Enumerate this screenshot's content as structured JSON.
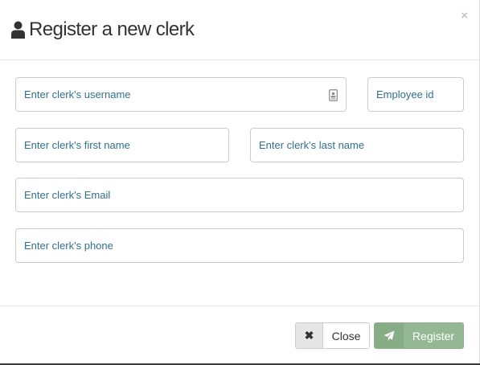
{
  "header": {
    "title": "Register a new clerk",
    "close_glyph": "×"
  },
  "form": {
    "username_placeholder": "Enter clerk's username",
    "employee_id_placeholder": "Employee id",
    "first_name_placeholder": "Enter clerk's first name",
    "last_name_placeholder": "Enter clerk's last name",
    "email_placeholder": "Enter clerk's Email",
    "phone_placeholder": "Enter clerk's phone"
  },
  "footer": {
    "close_label": "Close",
    "close_glyph": "✖",
    "register_label": "Register"
  },
  "icons": {
    "title_icon": "user-icon",
    "username_icon": "id-card-icon",
    "register_icon": "paper-plane-icon"
  },
  "colors": {
    "placeholder_text": "#31708f",
    "register_button": "#93b893"
  }
}
